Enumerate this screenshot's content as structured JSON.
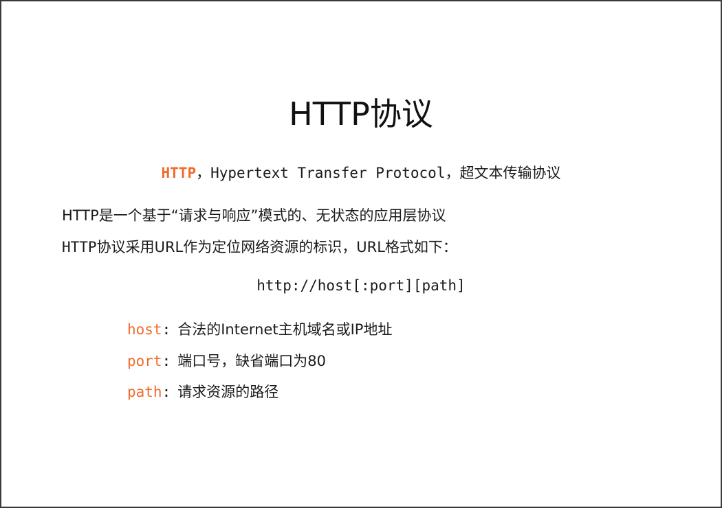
{
  "slide": {
    "title": "HTTP协议",
    "subtitle": {
      "acronym": "HTTP",
      "sep1": "，",
      "full_name": "Hypertext Transfer Protocol",
      "sep2": "，",
      "chinese": "超文本传输协议"
    },
    "line1": "HTTP是一个基于“请求与响应”模式的、无状态的应用层协议",
    "line2": {
      "prefix": "HTTP",
      "text": "协议采用URL作为定位网络资源的标识，URL格式如下："
    },
    "url_format": "http://host[:port][path]",
    "params": [
      {
        "name": "host",
        "colon": ":",
        "description": "合法的Internet主机域名或IP地址"
      },
      {
        "name": "port",
        "colon": ":",
        "description": "端口号，缺省端口为80"
      },
      {
        "name": "path",
        "colon": ":",
        "description": "请求资源的路径"
      }
    ]
  },
  "colors": {
    "accent": "#f26b2a",
    "text": "#1a1a1a",
    "border": "#3a3a3a"
  }
}
